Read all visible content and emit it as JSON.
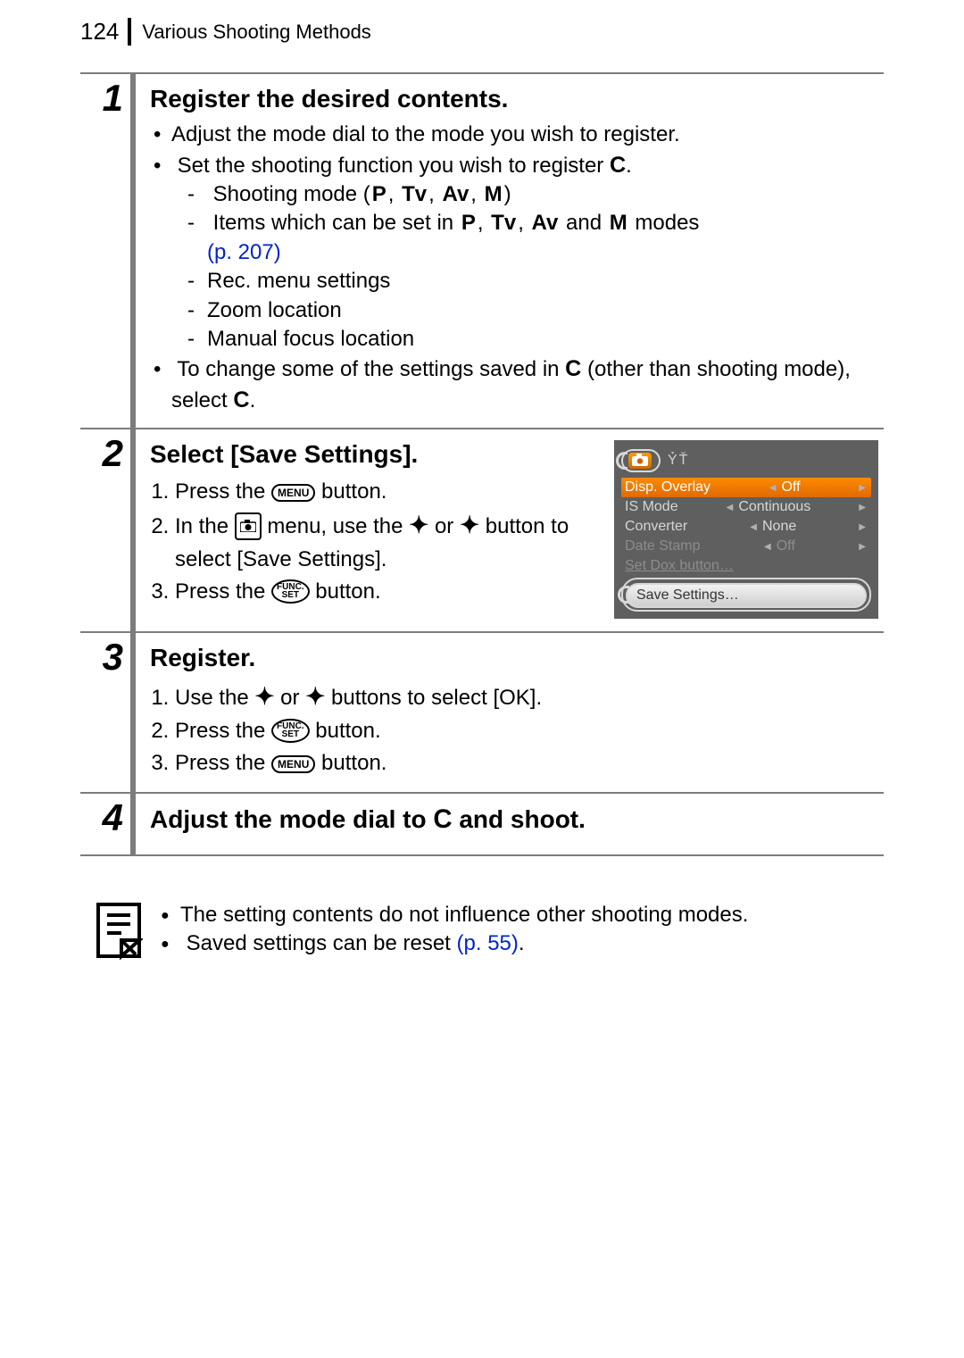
{
  "header": {
    "page_number": "124",
    "section_title": "Various Shooting Methods"
  },
  "steps": [
    {
      "num": "1",
      "title": "Register the desired contents.",
      "b1": "Adjust the mode dial to the mode you wish to register.",
      "b2": "Set the shooting function you wish to register ",
      "d1a": "Shooting mode (",
      "modes": {
        "p": "P",
        "tv": "Tv",
        "av": "Av",
        "m": "M"
      },
      "d1b": ")",
      "d2a": "Items which can be set in ",
      "d2b": " and ",
      "d2c": " modes ",
      "d2link": "(p. 207)",
      "d3": "Rec. menu settings",
      "d4": "Zoom location",
      "d5": "Manual focus location",
      "b3a": "To change some of the settings saved in ",
      "b3b": " (other than shooting mode), select ",
      "period": "."
    },
    {
      "num": "2",
      "title": "Select [Save Settings].",
      "o1a": "Press the ",
      "menu_label": "MENU",
      "o1b": " button.",
      "o2a": "In the ",
      "o2b": " menu, use the ",
      "o2c": " or ",
      "o2d": " button to select [Save Settings].",
      "o3a": "Press the ",
      "func_top": "FUNC.",
      "func_bot": "SET",
      "o3b": " button."
    },
    {
      "num": "3",
      "title": "Register.",
      "o1a": "Use the ",
      "o1b": " or ",
      "o1c": " buttons to select [OK].",
      "o2a": "Press the ",
      "o2b": " button.",
      "o3a": "Press the ",
      "o3b": " button."
    },
    {
      "num": "4",
      "title_a": "Adjust the mode dial to ",
      "title_b": " and shoot."
    }
  ],
  "lcd": {
    "tools_label": "ỶŤ",
    "rows": [
      {
        "label": "Disp. Overlay",
        "value": "Off",
        "hl": true
      },
      {
        "label": "IS Mode",
        "value": "Continuous"
      },
      {
        "label": "Converter",
        "value": "None"
      },
      {
        "label": "Date Stamp",
        "value": "Off",
        "dim": true
      },
      {
        "label": "Set Dox button…",
        "value": "",
        "dim": true
      }
    ],
    "save_label": "Save Settings…"
  },
  "notes": {
    "n1": "The setting contents do not influence other shooting modes.",
    "n2a": "Saved settings can be reset ",
    "n2link": "(p. 55)",
    "n2b": "."
  }
}
